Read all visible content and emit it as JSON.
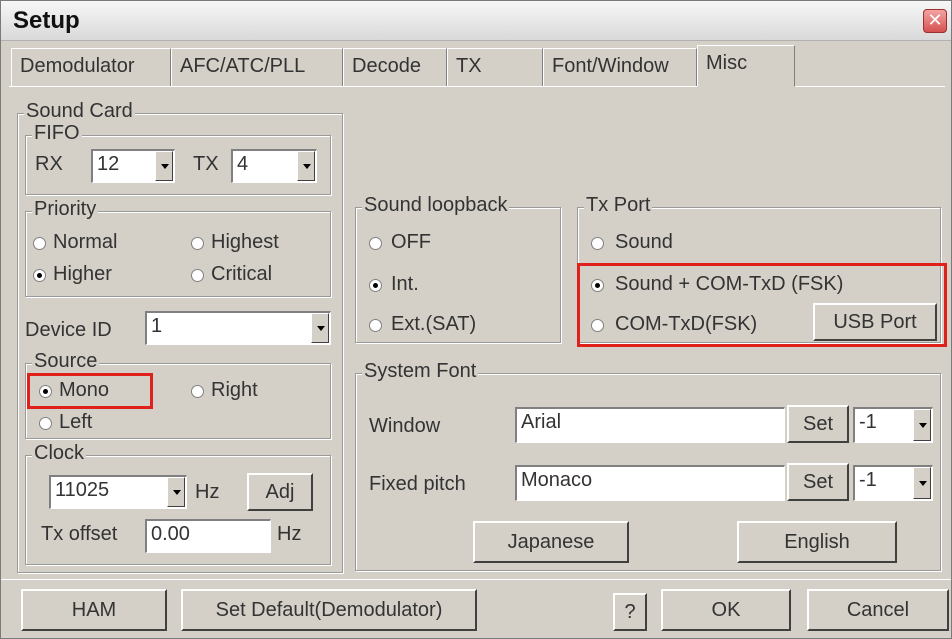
{
  "window": {
    "title": "Setup",
    "close_glyph": "✕",
    "close_icon": "close-icon"
  },
  "tabs": [
    "Demodulator",
    "AFC/ATC/PLL",
    "Decode",
    "TX",
    "Font/Window",
    "Misc"
  ],
  "active_tab": "Misc",
  "sound_card": {
    "label": "Sound Card",
    "fifo": {
      "label": "FIFO",
      "rx_label": "RX",
      "rx_value": "12",
      "tx_label": "TX",
      "tx_value": "4"
    },
    "priority": {
      "label": "Priority",
      "options": [
        "Normal",
        "Highest",
        "Higher",
        "Critical"
      ],
      "selected": "Higher"
    },
    "device_id": {
      "label": "Device ID",
      "value": "1"
    },
    "source": {
      "label": "Source",
      "options": [
        "Mono",
        "Right",
        "Left"
      ],
      "selected": "Mono"
    },
    "clock": {
      "label": "Clock",
      "value": "11025",
      "hz": "Hz",
      "adj": "Adj",
      "tx_offset_label": "Tx offset",
      "tx_offset_value": "0.00",
      "tx_offset_unit": "Hz"
    }
  },
  "sound_loopback": {
    "label": "Sound loopback",
    "options": [
      "OFF",
      "Int.",
      "Ext.(SAT)"
    ],
    "selected": "Int."
  },
  "tx_port": {
    "label": "Tx Port",
    "options": [
      "Sound",
      "Sound + COM-TxD (FSK)",
      "COM-TxD(FSK)"
    ],
    "selected": "Sound + COM-TxD (FSK)",
    "usb_port": "USB Port"
  },
  "system_font": {
    "label": "System Font",
    "window_label": "Window",
    "window_font": "Arial",
    "window_set": "Set",
    "window_size": "-1",
    "fixed_label": "Fixed pitch",
    "fixed_font": "Monaco",
    "fixed_set": "Set",
    "fixed_size": "-1",
    "japanese": "Japanese",
    "english": "English"
  },
  "bottom": {
    "ham": "HAM",
    "set_default": "Set Default(Demodulator)",
    "help": "?",
    "ok": "OK",
    "cancel": "Cancel"
  },
  "colors": {
    "highlight_box": "#e0201a",
    "dialog_bg": "#d4d0c8"
  }
}
